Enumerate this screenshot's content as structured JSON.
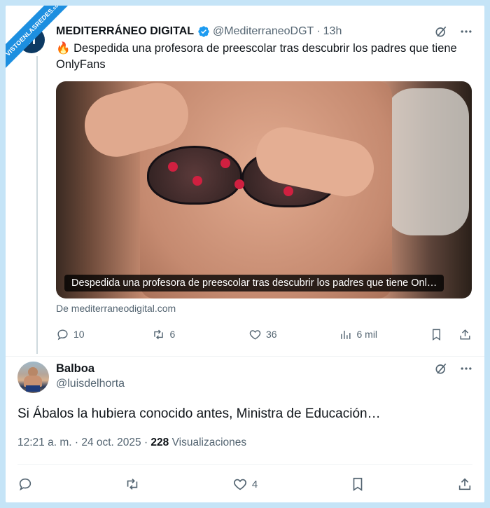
{
  "watermark": {
    "line1": "VISTOENLASREDES",
    "line2": ".com"
  },
  "tweet": {
    "avatar_letter": "n",
    "author": "MEDITERRÁNEO DIGITAL",
    "handle": "@MediterraneoDGT",
    "separator": "·",
    "time": "13h",
    "emoji": "🔥",
    "text": "Despedida una profesora de preescolar tras descubrir los padres que tiene OnlyFans",
    "media_caption": "Despedida una profesora de preescolar tras descubrir los padres que tiene Onl…",
    "source": "De mediterraneodigital.com",
    "stats": {
      "replies": "10",
      "retweets": "6",
      "likes": "36",
      "views": "6 mil"
    }
  },
  "reply": {
    "name": "Balboa",
    "handle": "@luisdelhorta",
    "text": "Si Ábalos la hubiera conocido antes, Ministra de Educación…",
    "time": "12:21 a. m. · 24 oct. 2025 ·",
    "views_count": "228",
    "views_label": "Visualizaciones",
    "likes": "4"
  },
  "colors": {
    "accent": "#1d9bf0",
    "muted": "#536471",
    "background": "#c5e4f7"
  }
}
